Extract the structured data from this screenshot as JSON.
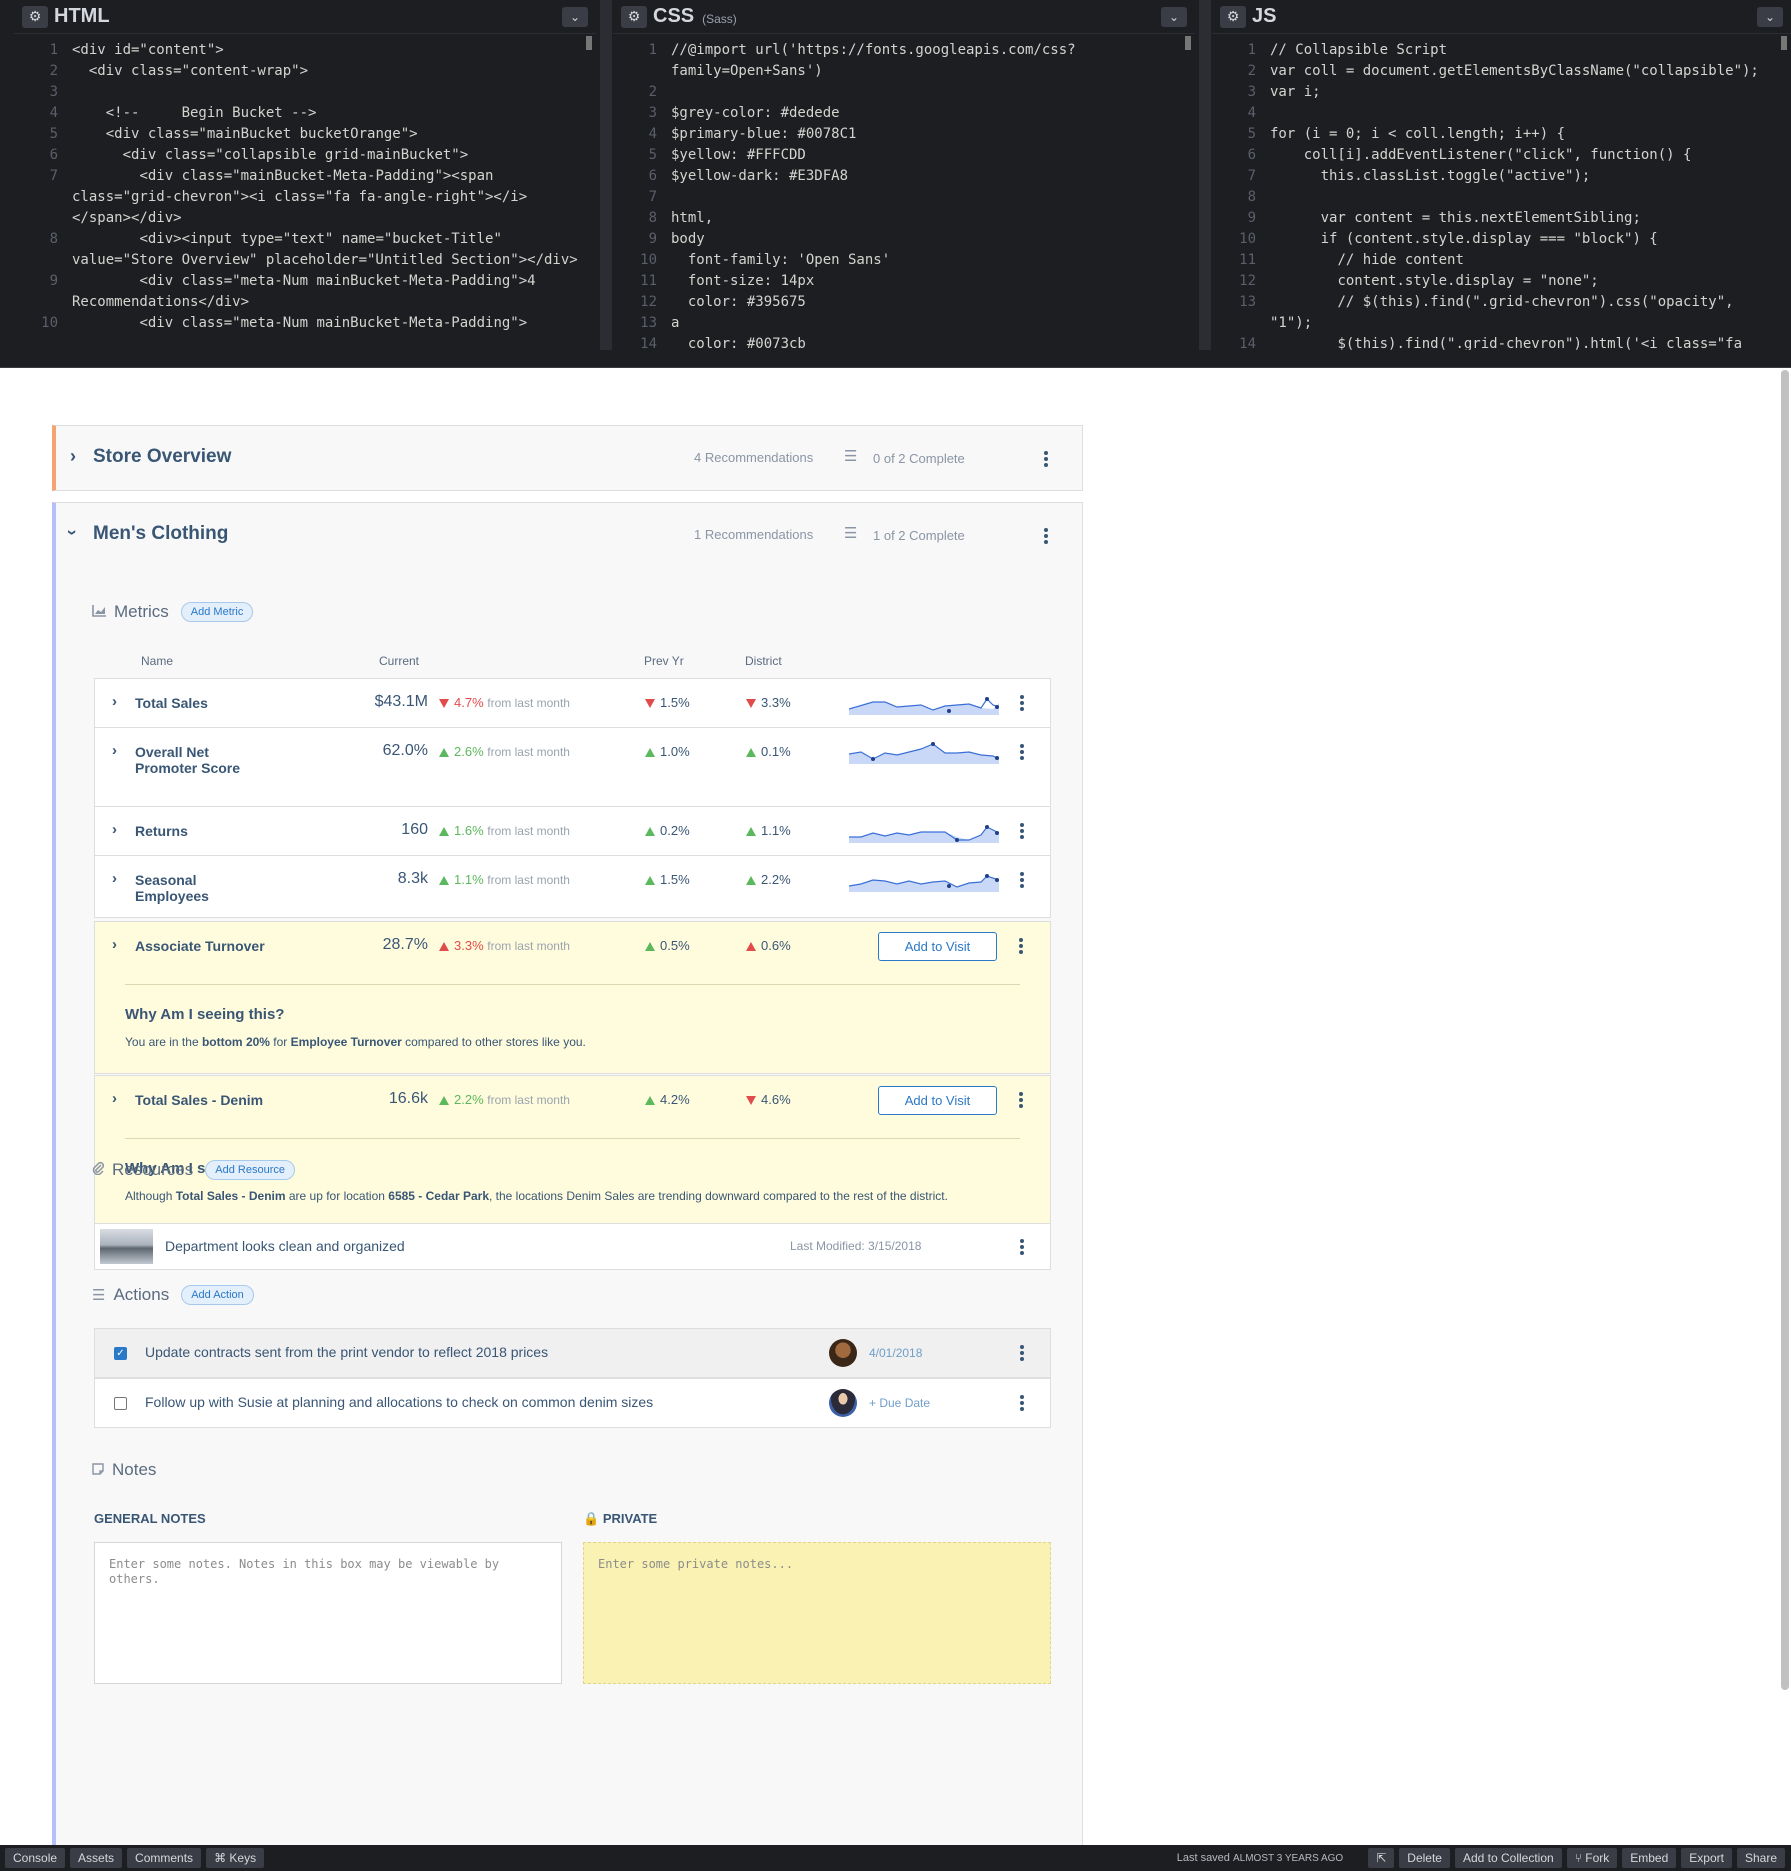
{
  "editor": {
    "html_title": "HTML",
    "css_title": "CSS",
    "css_sub": "(Sass)",
    "js_title": "JS",
    "html_lines": [
      {
        "n": "1",
        "t": "<div id=\"content\">"
      },
      {
        "n": "2",
        "t": "  <div class=\"content-wrap\">"
      },
      {
        "n": "3",
        "t": ""
      },
      {
        "n": "4",
        "t": "    <!--     Begin Bucket -->"
      },
      {
        "n": "5",
        "t": "    <div class=\"mainBucket bucketOrange\">"
      },
      {
        "n": "6",
        "t": "      <div class=\"collapsible grid-mainBucket\">"
      },
      {
        "n": "7",
        "t": "        <div class=\"mainBucket-Meta-Padding\"><span class=\"grid-chevron\"><i class=\"fa fa-angle-right\"></i></span></div>"
      },
      {
        "n": "8",
        "t": "        <div><input type=\"text\" name=\"bucket-Title\" value=\"Store Overview\" placeholder=\"Untitled Section\"></div>"
      },
      {
        "n": "9",
        "t": "        <div class=\"meta-Num mainBucket-Meta-Padding\">4 Recommendations</div>"
      },
      {
        "n": "10",
        "t": "        <div class=\"meta-Num mainBucket-Meta-Padding\">"
      }
    ],
    "css_lines": [
      {
        "n": "1",
        "t": "//@import url('https://fonts.googleapis.com/css?family=Open+Sans')"
      },
      {
        "n": "2",
        "t": ""
      },
      {
        "n": "3",
        "t": "$grey-color: #dedede"
      },
      {
        "n": "4",
        "t": "$primary-blue: #0078C1"
      },
      {
        "n": "5",
        "t": "$yellow: #FFFCDD"
      },
      {
        "n": "6",
        "t": "$yellow-dark: #E3DFA8"
      },
      {
        "n": "7",
        "t": ""
      },
      {
        "n": "8",
        "t": "html,"
      },
      {
        "n": "9",
        "t": "body"
      },
      {
        "n": "10",
        "t": "  font-family: 'Open Sans'"
      },
      {
        "n": "11",
        "t": "  font-size: 14px"
      },
      {
        "n": "12",
        "t": "  color: #395675"
      },
      {
        "n": "13",
        "t": "a"
      },
      {
        "n": "14",
        "t": "  color: #0073cb"
      }
    ],
    "js_lines": [
      {
        "n": "1",
        "t": "// Collapsible Script"
      },
      {
        "n": "2",
        "t": "var coll = document.getElementsByClassName(\"collapsible\");"
      },
      {
        "n": "3",
        "t": "var i;"
      },
      {
        "n": "4",
        "t": ""
      },
      {
        "n": "5",
        "t": "for (i = 0; i < coll.length; i++) {"
      },
      {
        "n": "6",
        "t": "    coll[i].addEventListener(\"click\", function() {"
      },
      {
        "n": "7",
        "t": "      this.classList.toggle(\"active\");"
      },
      {
        "n": "8",
        "t": ""
      },
      {
        "n": "9",
        "t": "      var content = this.nextElementSibling;"
      },
      {
        "n": "10",
        "t": "      if (content.style.display === \"block\") {"
      },
      {
        "n": "11",
        "t": "        // hide content"
      },
      {
        "n": "12",
        "t": "        content.style.display = \"none\";"
      },
      {
        "n": "13",
        "t": "        // $(this).find(\".grid-chevron\").css(\"opacity\", \"1\");"
      },
      {
        "n": "14",
        "t": "        $(this).find(\".grid-chevron\").html('<i class=\"fa"
      }
    ]
  },
  "buckets": {
    "store": {
      "title": "Store Overview",
      "recs": "4 Recommendations",
      "complete": "0 of 2 Complete"
    },
    "mens": {
      "title": "Men's Clothing",
      "recs": "1 Recommendations",
      "complete": "1 of 2 Complete"
    }
  },
  "metrics": {
    "title": "Metrics",
    "add": "Add Metric",
    "headers": {
      "name": "Name",
      "current": "Current",
      "prev": "Prev Yr",
      "district": "District"
    },
    "delta_label": "from last month",
    "add_to_visit": "Add to Visit",
    "rows": [
      {
        "name": "Total Sales",
        "current": "$43.1M",
        "delta": "4.7%",
        "prev": "1.5%",
        "district": "3.3%"
      },
      {
        "name": "Overall Net Promoter Score",
        "current": "62.0%",
        "delta": "2.6%",
        "prev": "1.0%",
        "district": "0.1%"
      },
      {
        "name": "Returns",
        "current": "160",
        "delta": "1.6%",
        "prev": "0.2%",
        "district": "1.1%"
      },
      {
        "name": "Seasonal Employees",
        "current": "8.3k",
        "delta": "1.1%",
        "prev": "1.5%",
        "district": "2.2%"
      },
      {
        "name": "Associate Turnover",
        "current": "28.7%",
        "delta": "3.3%",
        "prev": "0.5%",
        "district": "0.6%"
      },
      {
        "name": "Total Sales - Denim",
        "current": "16.6k",
        "delta": "2.2%",
        "prev": "4.2%",
        "district": "4.6%"
      }
    ],
    "why_title": "Why Am I seeing this?",
    "why1": {
      "a": "You are in the ",
      "b1": "bottom 20%",
      "c": " for ",
      "b2": "Employee Turnover",
      "d": " compared to other stores like you."
    },
    "why2": {
      "a": "Although ",
      "b1": "Total Sales - Denim",
      "c": " are up for location ",
      "b2": "6585 - Cedar Park",
      "d": ", the locations Denim Sales are trending downward compared to the rest of the district."
    }
  },
  "resources": {
    "title": "Resources",
    "add": "Add Resource",
    "item_title": "Department looks clean and organized",
    "modified": "Last Modified: 3/15/2018"
  },
  "actions": {
    "title": "Actions",
    "add": "Add Action",
    "items": [
      {
        "text": "Update contracts sent from the print vendor to reflect 2018 prices",
        "date": "4/01/2018",
        "checked": true
      },
      {
        "text": "Follow up with Susie at planning and allocations to check on common denim sizes",
        "date": "+ Due Date",
        "checked": false
      }
    ]
  },
  "notes": {
    "title": "Notes",
    "general_label": "GENERAL NOTES",
    "private_label": "PRIVATE",
    "general_placeholder": "Enter some notes. Notes in this box may be viewable by others.",
    "private_placeholder": "Enter some private notes..."
  },
  "footer": {
    "console": "Console",
    "assets": "Assets",
    "comments": "Comments",
    "keys": "⌘ Keys",
    "saved_prefix": "Last saved ",
    "saved_when": "almost 3 years ago",
    "delete": "Delete",
    "add_collection": "Add to Collection",
    "fork": "Fork",
    "embed": "Embed",
    "export": "Export",
    "share": "Share"
  },
  "colors": {
    "primary_blue": "#2a78c8",
    "text": "#395675",
    "yellow": "#FFFCDD",
    "orange_accent": "#f4a373",
    "purple_accent": "#b6bff7",
    "up_green": "#5cb85c",
    "down_red": "#e04b4b"
  }
}
